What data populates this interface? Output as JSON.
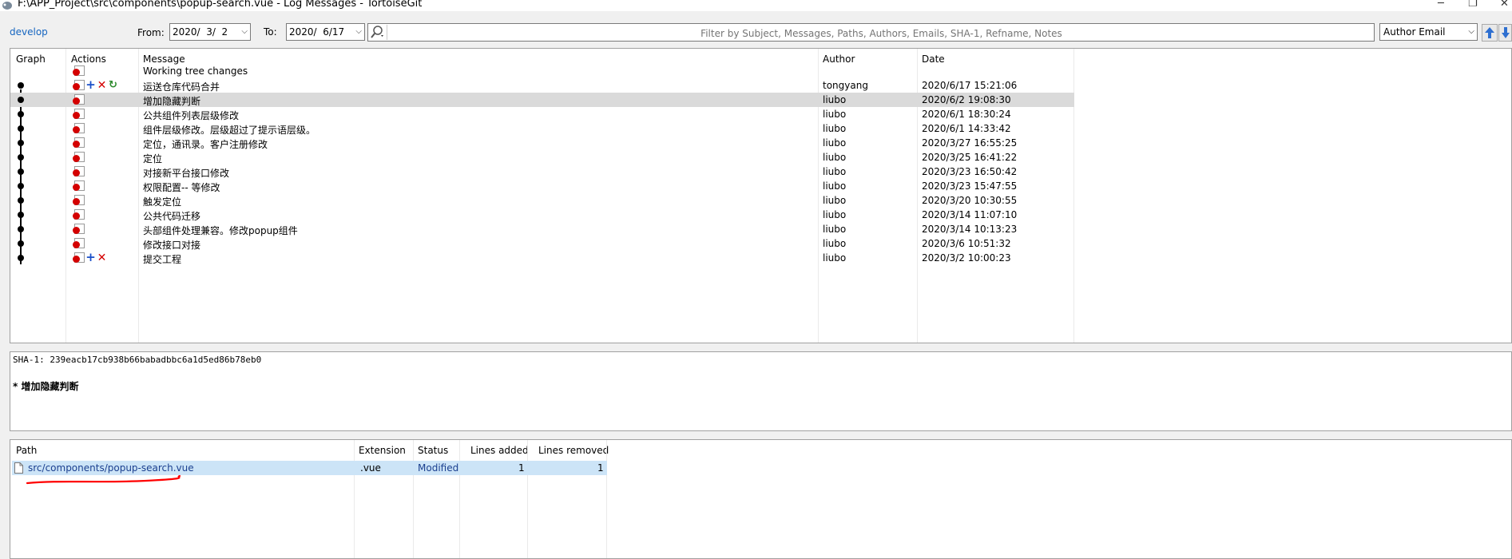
{
  "window": {
    "title": "F:\\APP_Project\\src\\components\\popup-search.vue - Log Messages - TortoiseGit",
    "minimize_glyph": "─",
    "restore_glyph": "❐",
    "close_glyph": "✕"
  },
  "toolbar": {
    "branch": "develop",
    "from_label": "From:",
    "from_value": "2020/  3/  2",
    "to_label": "To:",
    "to_value": "2020/  6/17",
    "search_placeholder": "Filter by Subject, Messages, Paths, Authors, Emails, SHA-1, Refname, Notes",
    "filter_field": "Author Email",
    "dropdown_glyph": "⌵",
    "search_glyph": "🔎",
    "up_glyph": "🡅",
    "down_glyph": "🡇"
  },
  "log": {
    "columns": [
      "Graph",
      "Actions",
      "Message",
      "Author",
      "Date"
    ],
    "rows": [
      {
        "message": "Working tree changes",
        "author": "",
        "date": "",
        "actions": [
          "modified"
        ],
        "graph": false
      },
      {
        "message": "运送仓库代码合并",
        "author": "tongyang",
        "date": "2020/6/17 15:21:06",
        "actions": [
          "modified",
          "added",
          "deleted",
          "renamed"
        ],
        "graph": true
      },
      {
        "message": "增加隐藏判断",
        "author": "liubo",
        "date": "2020/6/2 19:08:30",
        "actions": [
          "modified"
        ],
        "graph": true,
        "selected": true
      },
      {
        "message": "公共组件列表层级修改",
        "author": "liubo",
        "date": "2020/6/1 18:30:24",
        "actions": [
          "modified"
        ],
        "graph": true
      },
      {
        "message": "组件层级修改。层级超过了提示语层级。",
        "author": "liubo",
        "date": "2020/6/1 14:33:42",
        "actions": [
          "modified"
        ],
        "graph": true
      },
      {
        "message": "定位，通讯录。客户注册修改",
        "author": "liubo",
        "date": "2020/3/27 16:55:25",
        "actions": [
          "modified"
        ],
        "graph": true
      },
      {
        "message": "定位",
        "author": "liubo",
        "date": "2020/3/25 16:41:22",
        "actions": [
          "modified"
        ],
        "graph": true
      },
      {
        "message": "对接新平台接口修改",
        "author": "liubo",
        "date": "2020/3/23 16:50:42",
        "actions": [
          "modified"
        ],
        "graph": true
      },
      {
        "message": "权限配置-- 等修改",
        "author": "liubo",
        "date": "2020/3/23 15:47:55",
        "actions": [
          "modified"
        ],
        "graph": true
      },
      {
        "message": "触发定位",
        "author": "liubo",
        "date": "2020/3/20 10:30:55",
        "actions": [
          "modified"
        ],
        "graph": true
      },
      {
        "message": "公共代码迁移",
        "author": "liubo",
        "date": "2020/3/14 11:07:10",
        "actions": [
          "modified"
        ],
        "graph": true
      },
      {
        "message": "头部组件处理兼容。修改popup组件",
        "author": "liubo",
        "date": "2020/3/14 10:13:23",
        "actions": [
          "modified"
        ],
        "graph": true
      },
      {
        "message": "修改接口对接",
        "author": "liubo",
        "date": "2020/3/6 10:51:32",
        "actions": [
          "modified"
        ],
        "graph": true
      },
      {
        "message": "提交工程",
        "author": "liubo",
        "date": "2020/3/2 10:00:23",
        "actions": [
          "modified",
          "added",
          "deleted"
        ],
        "graph": true
      }
    ]
  },
  "details": {
    "sha": "SHA-1: 239eacb17cb938b66babadbbc6a1d5ed86b78eb0",
    "message": "* 增加隐藏判断"
  },
  "files": {
    "columns": [
      "Path",
      "Extension",
      "Status",
      "Lines added",
      "Lines removed"
    ],
    "rows": [
      {
        "path": "src/components/popup-search.vue",
        "extension": ".vue",
        "status": "Modified",
        "added": "1",
        "removed": "1"
      }
    ]
  },
  "icons": {
    "modified": "",
    "added": "+",
    "deleted": "✕",
    "renamed": "↻"
  },
  "colors": {
    "link_blue": "#1565c0",
    "selected_row": "#dadada",
    "file_selected": "#cce4f7",
    "annotation_red": "#ff0000"
  }
}
